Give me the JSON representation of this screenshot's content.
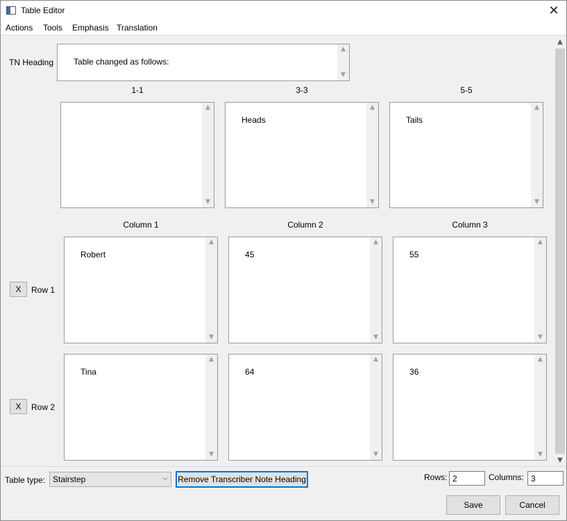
{
  "window": {
    "title": "Table Editor"
  },
  "menu": {
    "items": [
      "Actions",
      "Tools",
      "Emphasis",
      "Translation"
    ]
  },
  "tn_heading": {
    "label": "TN Heading",
    "value": "Table changed as follows:"
  },
  "header_cells": [
    {
      "label": "1-1",
      "value": ""
    },
    {
      "label": "3-3",
      "value": "Heads"
    },
    {
      "label": "5-5",
      "value": "Tails"
    }
  ],
  "columns": [
    "Column 1",
    "Column 2",
    "Column 3"
  ],
  "rows": [
    {
      "label": "Row 1",
      "remove_label": "X",
      "cells": [
        "Robert",
        "45",
        "55"
      ]
    },
    {
      "label": "Row 2",
      "remove_label": "X",
      "cells": [
        "Tina",
        "64",
        "36"
      ]
    }
  ],
  "bottom": {
    "table_type_label": "Table type:",
    "table_type_value": "Stairstep",
    "remove_tn_button": "Remove Transcriber Note Heading",
    "rows_label": "Rows:",
    "rows_value": "2",
    "columns_label": "Columns:",
    "columns_value": "3",
    "save_button": "Save",
    "cancel_button": "Cancel"
  },
  "icons": {
    "close": "close-icon",
    "scroll_up": "chevron-up-icon",
    "scroll_down": "chevron-down-icon",
    "dropdown": "chevron-down-icon"
  },
  "colors": {
    "focus": "#0078d7",
    "window_bg": "#f0f0f0"
  }
}
